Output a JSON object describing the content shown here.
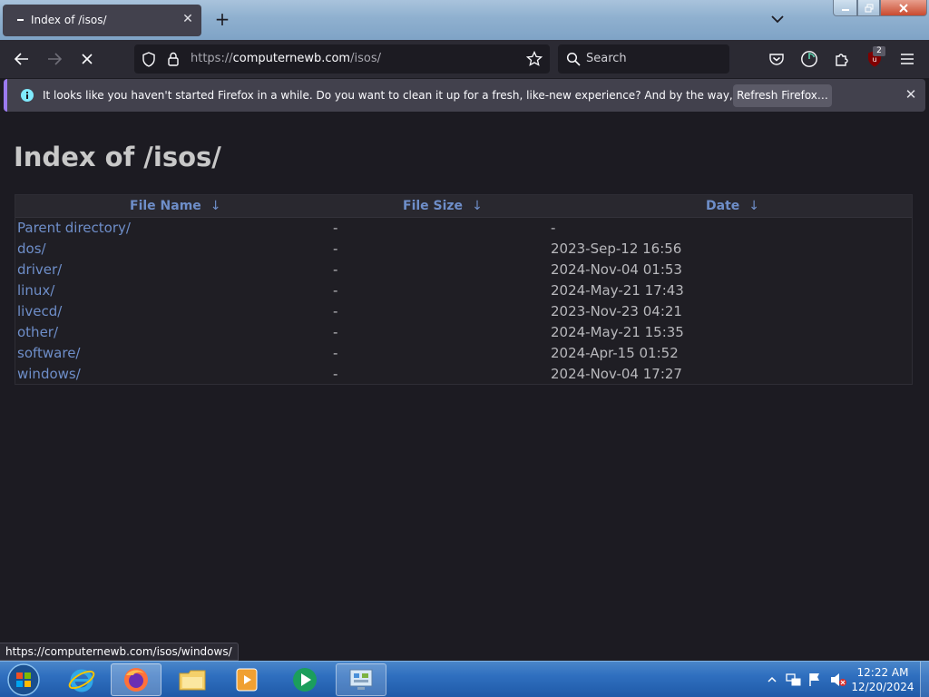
{
  "browser": {
    "tab_title": "Index of /isos/",
    "url_prefix": "https://",
    "url_host": "computernewb.com",
    "url_path": "/isos/",
    "search_placeholder": "Search",
    "extension_badge": "2"
  },
  "notification": {
    "message": "It looks like you haven't started Firefox in a while. Do you want to clean it up for a fresh, like-new experience? And by the way, welcome back!",
    "button_label": "Refresh Firefox…"
  },
  "page": {
    "title": "Index of /isos/",
    "columns": {
      "name": "File Name",
      "size": "File Size",
      "date": "Date",
      "sort_arrow": "↓"
    },
    "rows": [
      {
        "name": "Parent directory/",
        "size": "-",
        "date": "-"
      },
      {
        "name": "dos/",
        "size": "-",
        "date": "2023-Sep-12 16:56"
      },
      {
        "name": "driver/",
        "size": "-",
        "date": "2024-Nov-04 01:53"
      },
      {
        "name": "linux/",
        "size": "-",
        "date": "2024-May-21 17:43"
      },
      {
        "name": "livecd/",
        "size": "-",
        "date": "2023-Nov-23 04:21"
      },
      {
        "name": "other/",
        "size": "-",
        "date": "2024-May-21 15:35"
      },
      {
        "name": "software/",
        "size": "-",
        "date": "2024-Apr-15 01:52"
      },
      {
        "name": "windows/",
        "size": "-",
        "date": "2024-Nov-04 17:27"
      }
    ]
  },
  "status_url": "https://computernewb.com/isos/windows/",
  "taskbar": {
    "time": "12:22 AM",
    "date": "12/20/2024"
  },
  "colors": {
    "link": "#6e8ec9",
    "page_bg": "#1c1b22",
    "toolbar_bg": "#2b2a33",
    "accent_notice": "#9b7bef"
  }
}
